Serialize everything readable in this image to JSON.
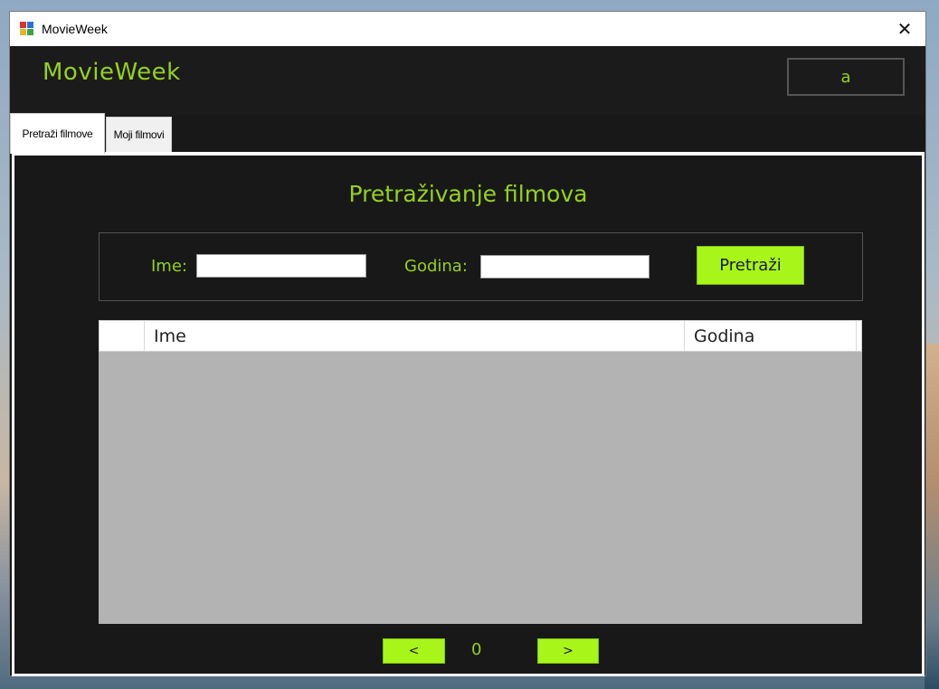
{
  "window": {
    "title": "MovieWeek",
    "close_glyph": "✕"
  },
  "header": {
    "brand": "MovieWeek",
    "user_button": "a"
  },
  "tabs": [
    {
      "label": "Pretraži filmove",
      "active": true
    },
    {
      "label": "Moji filmovi",
      "active": false
    }
  ],
  "search": {
    "title": "Pretraživanje filmova",
    "name_label": "Ime:",
    "name_value": "",
    "year_label": "Godina:",
    "year_value": "",
    "submit_label": "Pretraži"
  },
  "grid": {
    "columns": [
      "",
      "Ime",
      "Godina"
    ],
    "rows": []
  },
  "pager": {
    "prev_label": "<",
    "page": "0",
    "next_label": ">"
  },
  "colors": {
    "accent": "#95d11d",
    "button": "#a8f51a",
    "background": "#181818"
  }
}
